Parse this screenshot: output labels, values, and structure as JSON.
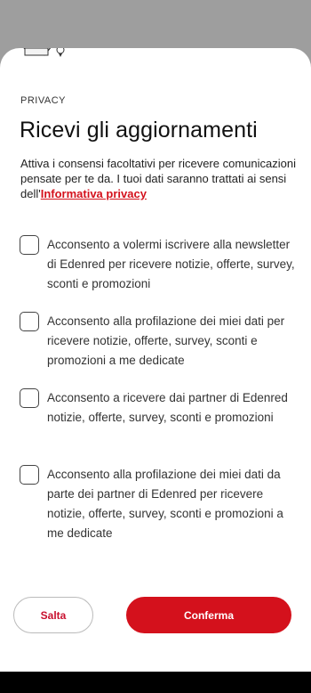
{
  "section_label": "PRIVACY",
  "title": "Ricevi gli aggiornamenti",
  "description": {
    "text": "Attiva i consensi facoltativi per ricevere comunicazioni pensate per te da. I tuoi dati saranno trattati ai sensi dell'",
    "link": "Informativa privacy"
  },
  "consents": [
    {
      "label": "Acconsento a volermi iscrivere alla newsletter di Edenred per ricevere notizie, offerte, survey, sconti e promozioni",
      "checked": false
    },
    {
      "label": "Acconsento alla profilazione dei miei dati per ricevere notizie, offerte, survey, sconti e promozioni a me dedicate",
      "checked": false
    },
    {
      "label": "Acconsento a ricevere dai partner di Edenred notizie, offerte, survey, sconti e promozioni",
      "checked": false
    },
    {
      "label": "Acconsento alla profilazione dei miei dati da parte dei partner di Edenred per ricevere notizie, offerte, survey, sconti e promozioni a me dedicate",
      "checked": false
    }
  ],
  "buttons": {
    "skip": "Salta",
    "confirm": "Conferma"
  },
  "colors": {
    "brand_red": "#d4111c",
    "overlay": "#9e9e9e"
  }
}
